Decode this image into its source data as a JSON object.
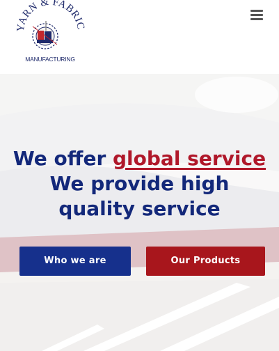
{
  "brand": {
    "arc_text": "YARN & FABRIC",
    "tagline": "MANUFACTURING"
  },
  "header": {
    "menu_icon": "hamburger-menu-icon"
  },
  "hero": {
    "headline_prefix": "We offer ",
    "headline_highlight": "global service",
    "headline_line2": "We provide high",
    "headline_line3": "quality service"
  },
  "buttons": {
    "primary": "Who we are",
    "secondary": "Our Products"
  },
  "colors": {
    "navy": "#13287a",
    "crimson": "#b0182a",
    "button_blue": "#16308c",
    "button_red": "#a8161c"
  }
}
